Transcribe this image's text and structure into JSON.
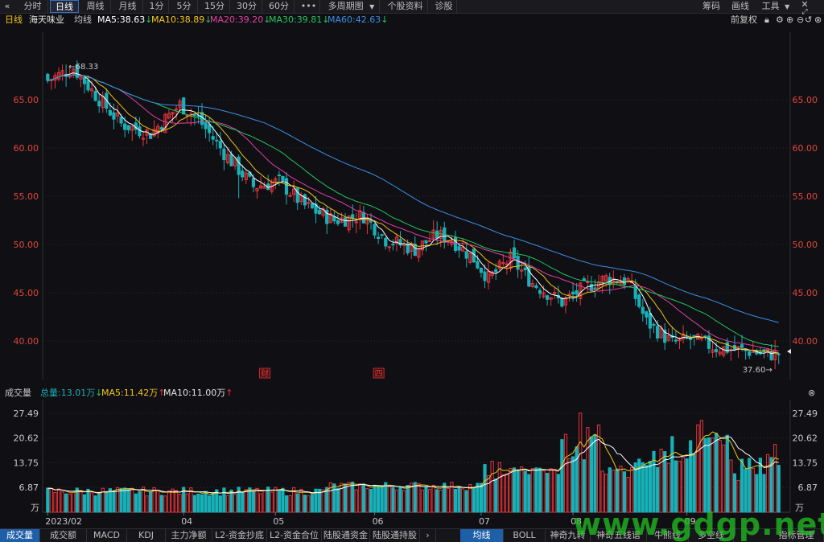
{
  "toolbar": {
    "back_icon": "double-chevron-left-icon",
    "tabs": [
      "分时",
      "日线",
      "周线",
      "月线",
      "1分",
      "5分",
      "15分",
      "30分",
      "60分"
    ],
    "active_tab": "日线",
    "more": "•••",
    "multi_period": "多周期图",
    "dropdown_icon": "caret-down-icon",
    "profile": "个股资料",
    "diagnosis": "诊股",
    "right": [
      "筹码",
      "画线",
      "工具"
    ],
    "close_icon": "close-icon",
    "expand_icon": "expand-arrows-icon"
  },
  "infobar": {
    "period": "日线",
    "stock": "海天味业",
    "avg_label": "均线",
    "ma": [
      {
        "label": "MA5:38.63",
        "arrow": "↓",
        "color": "#ffffff"
      },
      {
        "label": "MA10:38.89",
        "arrow": "↓",
        "color": "#f0c419"
      },
      {
        "label": "MA20:39.20",
        "arrow": "↓",
        "color": "#e040a0"
      },
      {
        "label": "MA30:39.81",
        "arrow": "↓",
        "color": "#22c55e"
      },
      {
        "label": "MA60:42.63",
        "arrow": "↓",
        "color": "#3a8ee6"
      }
    ],
    "adjust": "前复权",
    "icons": [
      "lock-icon",
      "gear-icon",
      "zoom-in-icon",
      "zoom-out-icon",
      "back-icon",
      "close-circle-icon"
    ]
  },
  "volume_header": {
    "label": "成交量",
    "total": "总量:13.01万",
    "total_arrow": "↓",
    "ma5": "MA5:11.42万",
    "ma5_arrow": "↑",
    "ma10": "MA10:11.00万",
    "ma10_arrow": "↑"
  },
  "bottom_tabs": {
    "left": [
      "成交量",
      "成交额",
      "MACD",
      "KDJ",
      "主力净额",
      "L2-资金抄底",
      "L2-资金合位",
      "陆股通资金",
      "陆股通持股"
    ],
    "active_left": "成交量",
    "arrow": "›",
    "right": [
      "均线",
      "BOLL",
      "神奇九转",
      "神奇五线谱",
      "牛熊线",
      "多空线"
    ],
    "active_right": "均线",
    "manage": "指标管理"
  },
  "watermark": "www.gdgp.net",
  "colors": {
    "up": "#e8343b",
    "down": "#19b1b8",
    "bg": "#101014",
    "grid": "#2a2a30",
    "axis_text": "#e0453a"
  },
  "chart_data": {
    "type": "candlestick",
    "price_axis": {
      "ticks": [
        40,
        45,
        50,
        55,
        60,
        65
      ],
      "labels": [
        "40.00",
        "45.00",
        "50.00",
        "55.00",
        "60.00",
        "65.00"
      ],
      "range": [
        36,
        72
      ]
    },
    "volume_axis": {
      "ticks": [
        6.87,
        13.75,
        20.62,
        27.49
      ],
      "labels": [
        "6.87",
        "13.75",
        "20.62",
        "27.49"
      ],
      "unit": "万",
      "range": [
        0,
        29
      ]
    },
    "x_labels": [
      "2023/02",
      "04",
      "05",
      "06",
      "07",
      "08",
      "09"
    ],
    "x_label_index": [
      0,
      37,
      62,
      89,
      118,
      143,
      174
    ],
    "annotations": {
      "high": "68.33",
      "high_index": 7,
      "low": "37.60→",
      "low_index": 199,
      "event_markers": [
        {
          "text": "财",
          "index": 59
        },
        {
          "text": "四",
          "index": 90
        }
      ]
    },
    "count": 200,
    "close_path": [
      [
        0,
        67.0
      ],
      [
        7,
        68.3
      ],
      [
        13,
        65.5
      ],
      [
        20,
        62.5
      ],
      [
        28,
        61.5
      ],
      [
        36,
        64.5
      ],
      [
        41,
        63.0
      ],
      [
        48,
        59.5
      ],
      [
        56,
        56.0
      ],
      [
        63,
        56.5
      ],
      [
        70,
        54.0
      ],
      [
        78,
        52.5
      ],
      [
        86,
        53.0
      ],
      [
        92,
        50.5
      ],
      [
        100,
        49.5
      ],
      [
        106,
        51.0
      ],
      [
        110,
        50.5
      ],
      [
        116,
        48.5
      ],
      [
        120,
        46.5
      ],
      [
        126,
        48.5
      ],
      [
        132,
        46.0
      ],
      [
        140,
        44.0
      ],
      [
        146,
        45.5
      ],
      [
        152,
        46.5
      ],
      [
        158,
        46.2
      ],
      [
        163,
        42.0
      ],
      [
        170,
        39.8
      ],
      [
        175,
        40.2
      ],
      [
        182,
        39.3
      ],
      [
        190,
        39.0
      ],
      [
        196,
        38.6
      ],
      [
        199,
        38.7
      ]
    ],
    "ma_values": {
      "MA5": "38.63",
      "MA10": "38.89",
      "MA20": "39.20",
      "MA30": "39.81",
      "MA60": "42.63"
    },
    "volume_last": "13.01"
  }
}
